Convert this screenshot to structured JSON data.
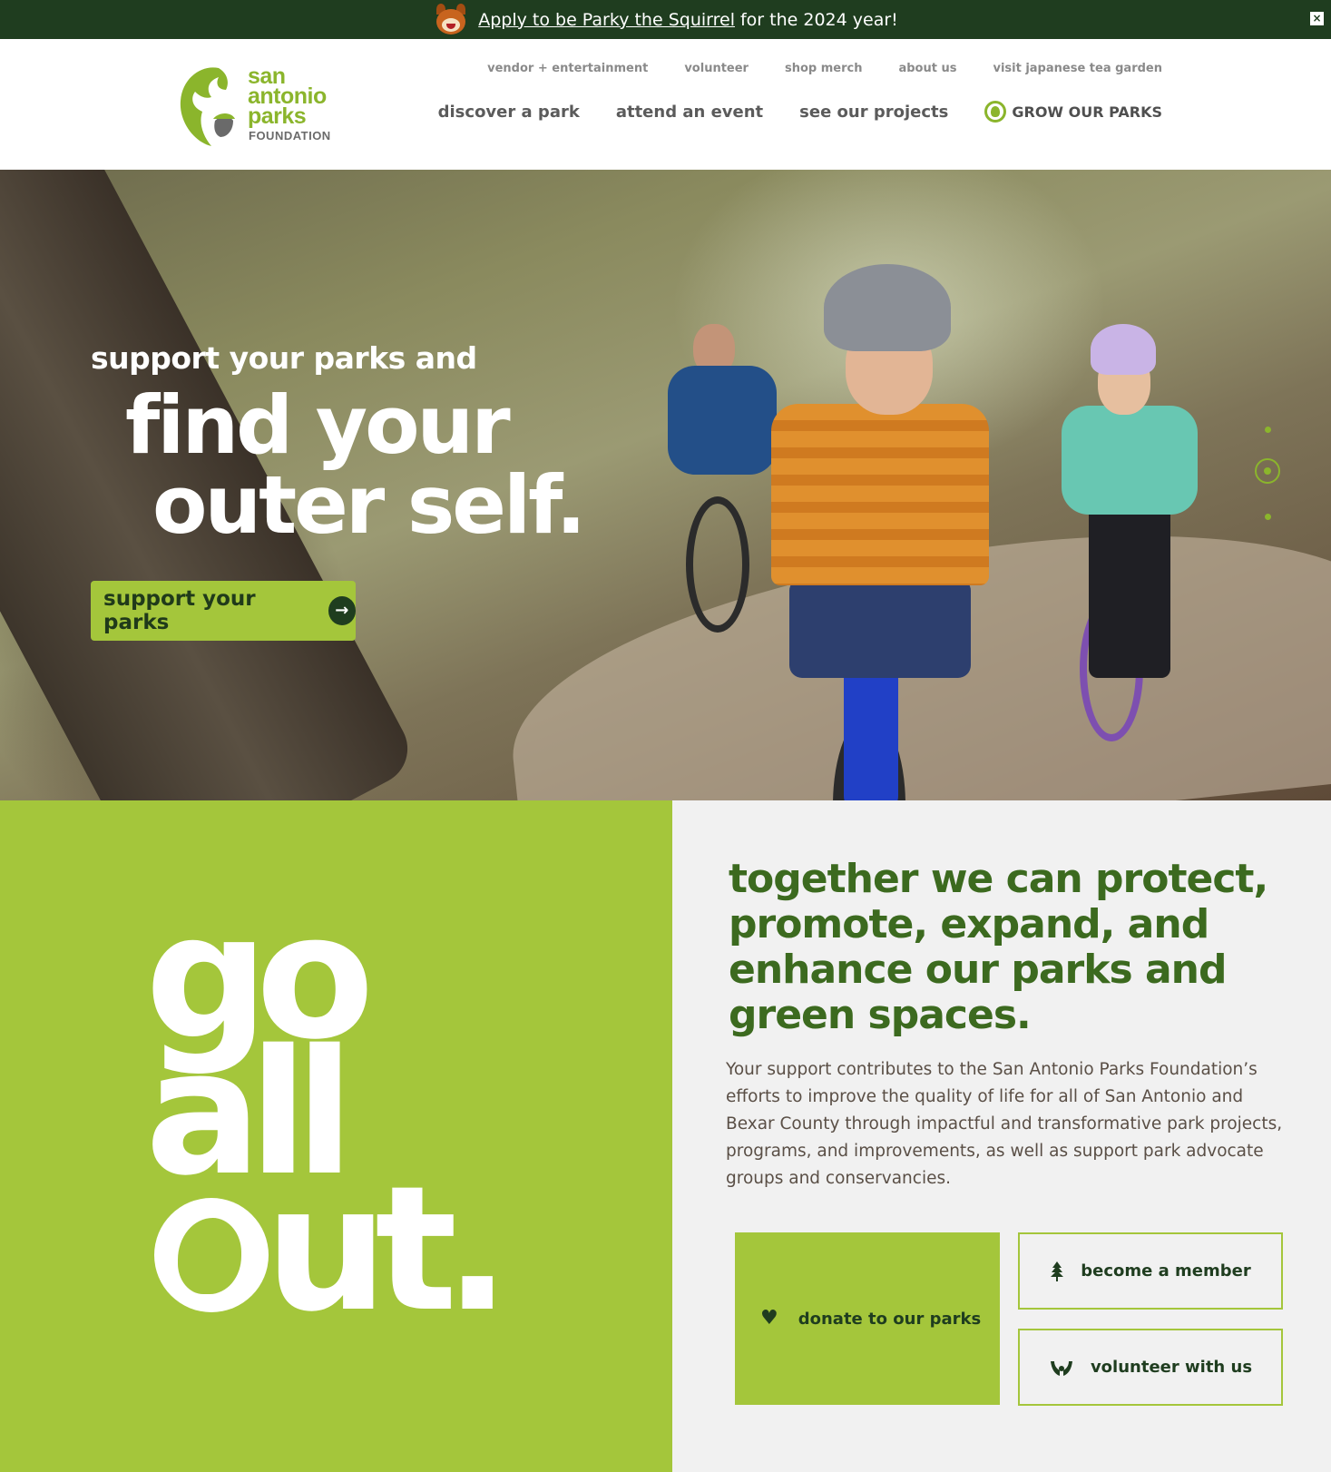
{
  "announcement": {
    "link_text": "Apply to be Parky the Squirrel",
    "tail_text": "for the 2024 year!",
    "close_icon": "close-icon"
  },
  "header": {
    "logo": {
      "line1": "san",
      "line2": "antonio",
      "line3": "parks",
      "sub": "FOUNDATION"
    },
    "utility_nav": [
      "vendor + entertainment",
      "volunteer",
      "shop merch",
      "about us",
      "visit japanese tea garden"
    ],
    "main_nav": [
      "discover a park",
      "attend an event",
      "see our projects"
    ],
    "grow_label": "GROW OUR PARKS"
  },
  "hero": {
    "kicker": "support your parks and",
    "title_line1": "find your",
    "title_line2": "outer self.",
    "button_label": "support your parks",
    "slides_count": 3,
    "active_slide": 2
  },
  "go_all_out": {
    "line1": "go",
    "line2": "all",
    "line3": "ut."
  },
  "mission": {
    "headline": "together we can protect, promote, expand, and enhance our parks and green spaces.",
    "body": "Your support contributes to the San Antonio Parks Foundation’s efforts to improve the quality of life for all of San Antonio and Bexar County through impactful and transformative park projects, programs, and improvements, as well as support park advocate groups and conservancies."
  },
  "ctas": {
    "donate": "donate to our parks",
    "member": "become a member",
    "volunteer": "volunteer with us"
  },
  "colors": {
    "brand_green": "#a4c63b",
    "dark_green": "#1f3d1f",
    "headline_green": "#3c6a1f"
  }
}
